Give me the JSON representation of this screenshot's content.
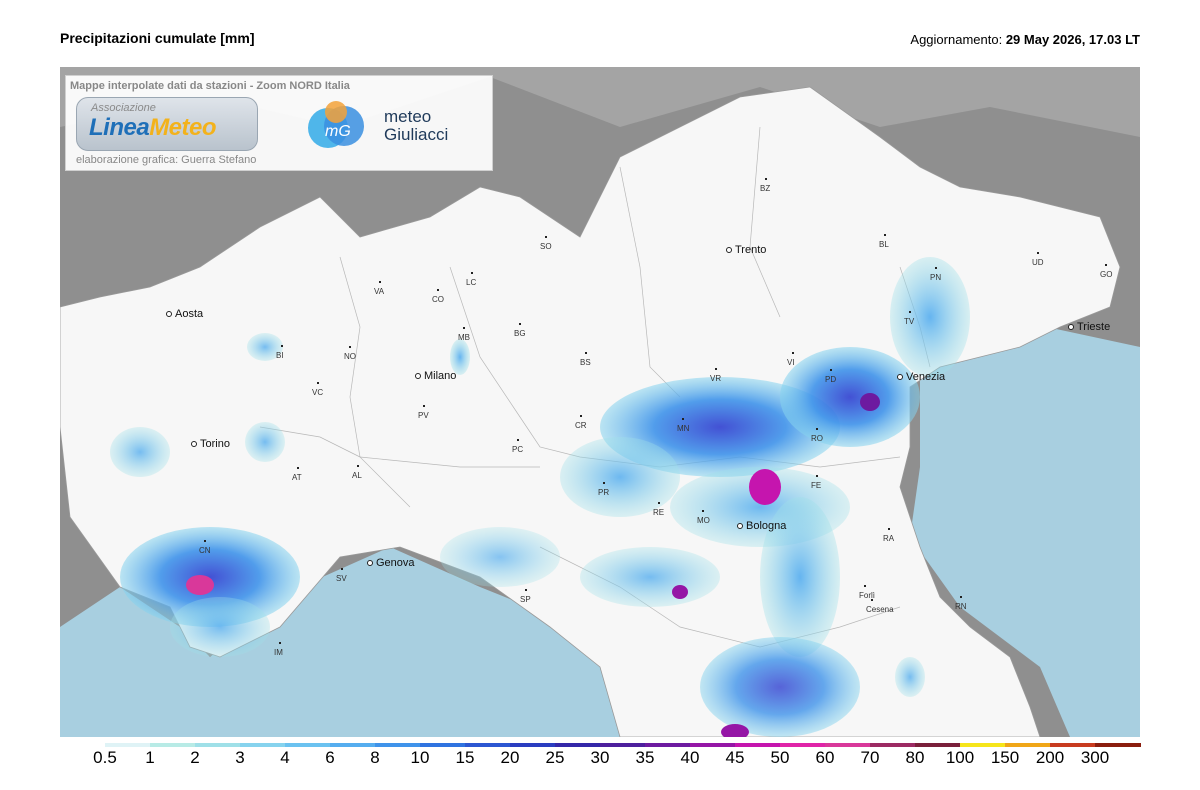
{
  "header": {
    "title": "Precipitazioni cumulate [mm]",
    "updated_label": "Aggiornamento:",
    "updated_value": "29 May 2026, 17.03 LT"
  },
  "credits": {
    "caption": "Mappe interpolate dati da stazioni - Zoom NORD Italia",
    "logo_assoc": "Associazione",
    "logo_name_a": "Linea",
    "logo_name_b": "Meteo",
    "partner_line1": "meteo",
    "partner_line2": "Giuliacci",
    "partner_mark": "mG",
    "author": "elaborazione grafica: Guerra Stefano"
  },
  "cities": {
    "aosta": "Aosta",
    "torino": "Torino",
    "milano": "Milano",
    "trento": "Trento",
    "venezia": "Venezia",
    "trieste": "Trieste",
    "genova": "Genova",
    "bologna": "Bologna"
  },
  "provinces": {
    "bz": "BZ",
    "so": "SO",
    "bl": "BL",
    "ud": "UD",
    "go": "GO",
    "pn": "PN",
    "tv": "TV",
    "va": "VA",
    "co": "CO",
    "lc": "LC",
    "bg": "BG",
    "mb": "MB",
    "bi": "BI",
    "no": "NO",
    "vc": "VC",
    "bs": "BS",
    "vr": "VR",
    "vi": "VI",
    "pd": "PD",
    "pv": "PV",
    "cr": "CR",
    "mn": "MN",
    "ro": "RO",
    "pc": "PC",
    "at": "AT",
    "al": "AL",
    "pr": "PR",
    "re": "RE",
    "mo": "MO",
    "fe": "FE",
    "ra": "RA",
    "cn": "CN",
    "sv": "SV",
    "sp": "SP",
    "fc": "Forlì",
    "cesena": "Cesena",
    "rn": "RN",
    "im": "IM"
  },
  "legend": {
    "ticks": [
      "0.5",
      "1",
      "2",
      "3",
      "4",
      "6",
      "8",
      "10",
      "15",
      "20",
      "25",
      "30",
      "35",
      "40",
      "45",
      "50",
      "60",
      "70",
      "80",
      "100",
      "150",
      "200",
      "300"
    ],
    "colors": [
      "#ffffff",
      "#dff3f6",
      "#b8ebe6",
      "#9fe0e8",
      "#86d3ee",
      "#6bc2f0",
      "#55adef",
      "#3f93ea",
      "#2f73e0",
      "#2c57d2",
      "#2a3dc0",
      "#3427a9",
      "#4d1f9d",
      "#6d1aa0",
      "#9516a6",
      "#c515ae",
      "#e024a8",
      "#d9389a",
      "#9c2a63",
      "#7a1f3a",
      "#f6e51a",
      "#f0a617",
      "#c83b1f",
      "#8a1d0e"
    ]
  }
}
